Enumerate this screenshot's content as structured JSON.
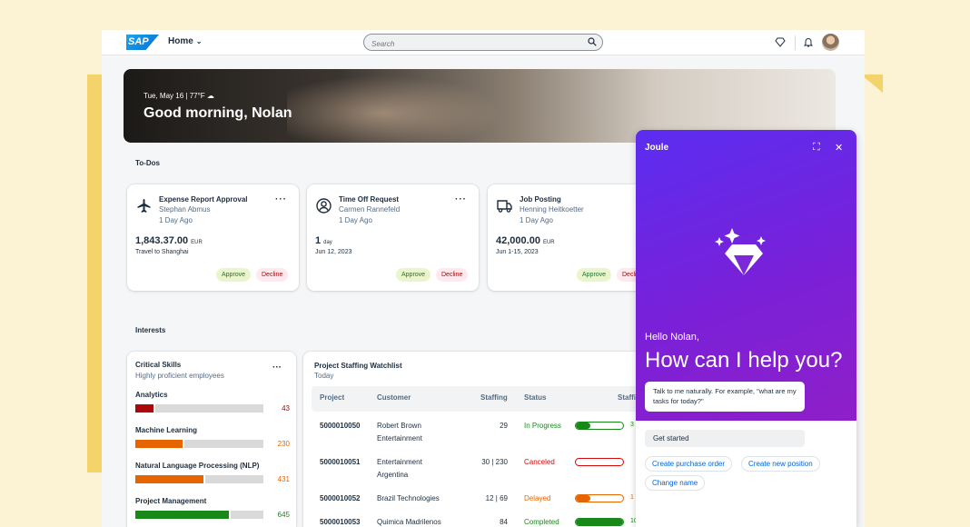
{
  "shell": {
    "logo_text": "SAP",
    "home_label": "Home",
    "search_placeholder": "Search"
  },
  "hero": {
    "date_weather": "Tue, May 16 | 77°F",
    "greeting": "Good morning, Nolan"
  },
  "todos": {
    "section_title": "To-Dos",
    "cards": [
      {
        "title": "Expense Report Approval",
        "person": "Stephan Abmus",
        "age": "1 Day Ago",
        "amount": "1,843.37.00",
        "unit": "EUR",
        "desc": "Travel to Shanghai",
        "icon": "airplane-icon",
        "approve": "Approve",
        "decline": "Decline"
      },
      {
        "title": "Time Off Request",
        "person": "Carmen Rannefeld",
        "age": "1 Day Ago",
        "amount": "1",
        "unit": "day",
        "desc": "Jun 12, 2023",
        "icon": "user-circle-icon",
        "approve": "Approve",
        "decline": "Decline"
      },
      {
        "title": "Job Posting",
        "person": "Henning Heitkoetter",
        "age": "1 Day Ago",
        "amount": "42,000.00",
        "unit": "EUR",
        "desc": "Jun 1-15, 2023",
        "icon": "truck-icon",
        "approve": "Approve",
        "decline": "Decline"
      }
    ]
  },
  "interests": {
    "section_title": "Interests",
    "skills": {
      "title": "Critical Skills",
      "subtitle": "Highly proficient employees",
      "items": [
        {
          "name": "Analytics",
          "value": "43",
          "fraction": 0.14,
          "color": "#aa0808",
          "value_color": "#aa0808"
        },
        {
          "name": "Machine Learning",
          "value": "230",
          "fraction": 0.37,
          "color": "#e76500",
          "value_color": "#e76500"
        },
        {
          "name": "Natural Language Processing (NLP)",
          "value": "431",
          "fraction": 0.53,
          "color": "#e76500",
          "value_color": "#e76500"
        },
        {
          "name": "Project Management",
          "value": "645",
          "fraction": 0.73,
          "color": "#188918",
          "value_color": "#188918"
        }
      ]
    },
    "watchlist": {
      "title": "Project Staffing Watchlist",
      "subtitle": "Today",
      "columns": [
        "Project",
        "Customer",
        "Staffing",
        "Status",
        "Staffi"
      ],
      "rows": [
        {
          "project": "5000010050",
          "customer_line1": "Robert Brown",
          "customer_line2": "Entertainment",
          "staffing": "29",
          "status": "In Progress",
          "status_color": "#188918",
          "progress": 0.3,
          "bar_color": "#188918",
          "trail": "3"
        },
        {
          "project": "5000010051",
          "customer_line1": "Entertainment",
          "customer_line2": "Argentina",
          "staffing": "30 | 230",
          "status": "Canceled",
          "status_color": "#d20a0a",
          "progress": 0,
          "bar_color": "#d20a0a",
          "trail": ""
        },
        {
          "project": "5000010052",
          "customer_line1": "Brazil Technologies",
          "customer_line2": "",
          "staffing": "12 | 69",
          "status": "Delayed",
          "status_color": "#e76500",
          "progress": 0.3,
          "bar_color": "#e76500",
          "trail": "1"
        },
        {
          "project": "5000010053",
          "customer_line1": "Quimica Madrilenos",
          "customer_line2": "",
          "staffing": "84",
          "status": "Completed",
          "status_color": "#188918",
          "progress": 1.0,
          "bar_color": "#188918",
          "trail": "10"
        }
      ]
    }
  },
  "joule": {
    "title": "Joule",
    "hello": "Hello Nolan,",
    "headline": "How can I help you?",
    "hint": "Talk to me naturally. For example, \"what are my tasks for today?\"",
    "get_started": "Get started",
    "suggestions": [
      "Create purchase order",
      "Create new position",
      "Change name"
    ]
  }
}
